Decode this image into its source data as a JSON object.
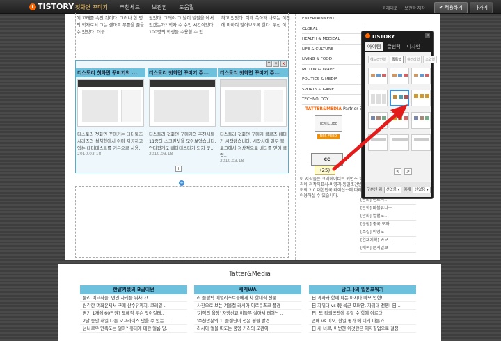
{
  "topbar": {
    "logo": "TISTORY",
    "logo_dot": "t",
    "tabs": [
      "첫화면 꾸미기",
      "추천세트",
      "보관함",
      "도움말"
    ],
    "links": [
      "원래대로",
      "보관함 저장"
    ],
    "apply_button": "적용하기",
    "exit_button": "나가기"
  },
  "content": {
    "col1_text": "에 고래를 속인 것이다. 그러나 한 명의 학자로서 그는 셀마프 무를을 꿇을 수 있었다. 더구..",
    "col2_text": "뒀었다. 그래야 그 날이 빌필을 에서 있겠는가? 학자 수 수업 시간이었다. 100명의 학생들 수용할 수 있..",
    "col3_text": "하고 있었다. 이때 쏙아져 나오는 이진에 마하여 많아보도록 한다. 우선 이..",
    "posts": [
      {
        "title": "티스토리 첫화면 꾸미기의 ...",
        "text": "티스토리 첫화면 꾸미기는 테터툴즈 시리즈의 설치형에서 이미 제공하고 있는 테터테스트를 기본으로 사용..",
        "date": "2010.03.18"
      },
      {
        "title": "티스토리 첫화면 꾸미기 주...",
        "text": "티스토리 첫화면 꾸미기의 추천세트 11종의 스크린샷을 모아보았습니다. 안타깝게도 베타테스터가 되지 못..",
        "date": "2010.03.18"
      },
      {
        "title": "티스토리 첫화면 꾸미기 주...",
        "text": "티스토리 첫화면 꾸미기 클로즈 베타가 시작됐습니다. 시작서에 일부 블로그에서 정상적으로 베타를 얻어 클릭..",
        "date": "2010.03.18"
      }
    ],
    "categories": [
      "ENTERTAINMENT",
      "GLOBAL",
      "HEALTH & MEDICAL",
      "LIFE & CULTURE",
      "LIVING & FOOD",
      "MOTOR & TRAVEL",
      "POLITICS & MEDIA",
      "SPORTS & GAME",
      "TECHNOLOGY"
    ],
    "partner_brand": "TATTER&MEDIA",
    "partner_label": "Partner Blog",
    "textcube": "TEXTCUBE",
    "rss": "RSS FEED",
    "cc_label": "CC",
    "counter": "(25)",
    "license_text": "이 저작물은 크리에이티브 커먼즈 코리아 저작자표시-비영리-동일조건변경허락 2.0 대한민국 라이선스에 따라 이용하실 수 있습니다.",
    "today_list": [
      "[만화] 핸드북..",
      "[만화] 마블유니스",
      "[만화] 열혈도..",
      "[분장] 중국 모자..",
      "[소설] 이명도",
      "[연재기획] 봐보..",
      "[애독] 문지일보"
    ]
  },
  "footer": {
    "title": "Tatter&Media",
    "columns": [
      {
        "header": "한알켜졌의 B급이썬",
        "items": [
          "물리 예고하들, 연인 자리를 뒤차다!",
          "심각한 며화운제서 구매 산수유까지, 코레일 ..",
          "땀기 1개에 60만원? 도매적 무슨 맛이길래..",
          "2달 동안 해일 다른 오프라이스 맛을 수 있는 ..",
          "넘나로우 만족도는 얼마? 휴대에 대한 일룸 망.."
        ]
      },
      {
        "header": "세계WA",
        "items": [
          "러 플람탁 에멀리스트들에게 차 한대식 선물",
          "사진으로 보는 겨울철 러시아 이르쿠츠크 풍경",
          "'기적의 올쟁' 자방선교 이들무 살아서 태어난 ..",
          "'수천만분의 1' 플랜딘이 접은 평원 발견",
          "러시아 얼을 떠도는 뭉양 커리의 모관이"
        ]
      },
      {
        "header": "당그나의 일본포워기",
        "items": [
          "日 과자와 함께 파는 아시다 마모 인형!",
          "日 자위대 vs 韓 육군 포퍼안, 자위대 전쟁! 日 ..",
          "日, 또 티뢰콤팩에 목질 수 학에 이르다",
          "연애 vs 야오, 한일 평가 에 이리 다른가",
          "日 새 녀르, 이번엔 이것한은 해저필업으로 걸정"
        ]
      }
    ]
  },
  "panel": {
    "logo": "TISTORY",
    "close": "x",
    "tabs": [
      "아이템",
      "글선택",
      "디자인"
    ],
    "sub_tabs": [
      "헤드라인형",
      "목록형",
      "갤러리형",
      "조합형"
    ],
    "footer_label1": "구분선",
    "footer_label2": "위",
    "footer_select1": "선없음",
    "footer_label3": "아래",
    "footer_select2": "선없음",
    "nav_prev": "<",
    "nav_next": ">"
  },
  "colors": {
    "accent": "#6ec1dd",
    "logo_orange": "#ff6600",
    "arrow_red": "#e41b1b",
    "panel_bg": "#1c1c1c"
  }
}
